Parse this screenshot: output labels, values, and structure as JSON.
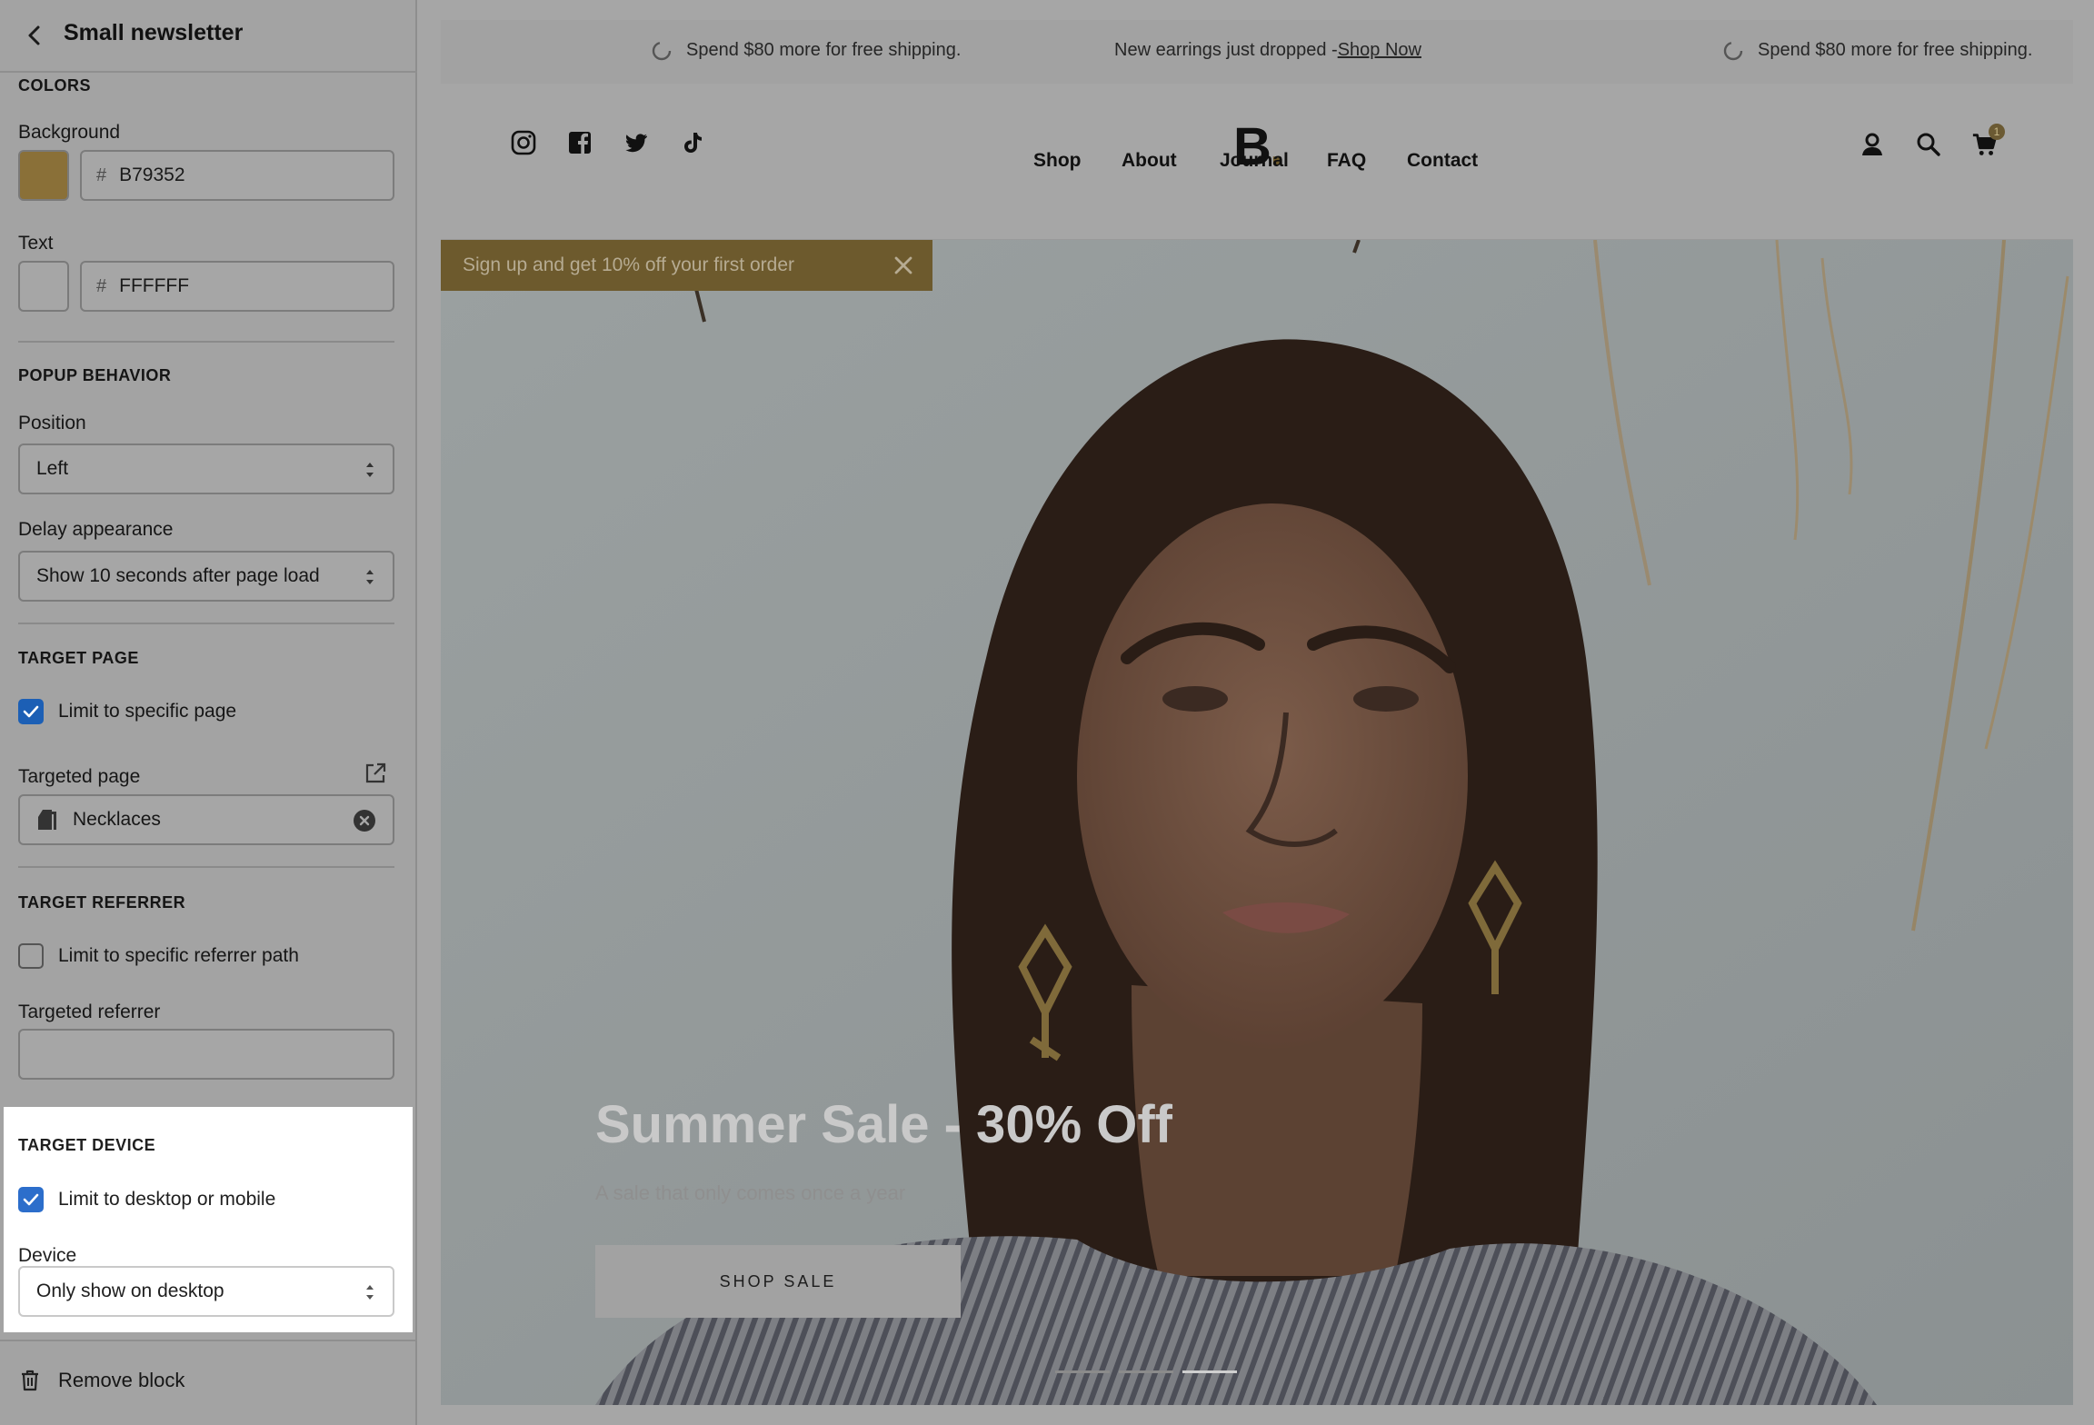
{
  "sidebar": {
    "title": "Small newsletter",
    "colors": {
      "heading": "COLORS",
      "background_label": "Background",
      "background_hash": "#",
      "background_value": "B79352",
      "background_color": "#8a7038",
      "text_label": "Text",
      "text_hash": "#",
      "text_value": "FFFFFF",
      "text_color": "#a6a6a6"
    },
    "popup_behavior": {
      "heading": "POPUP BEHAVIOR",
      "position_label": "Position",
      "position_value": "Left",
      "delay_label": "Delay appearance",
      "delay_value": "Show 10 seconds after page load"
    },
    "target_page": {
      "heading": "TARGET PAGE",
      "limit_label": "Limit to specific page",
      "limit_checked": true,
      "targeted_label": "Targeted page",
      "targeted_value": "Necklaces"
    },
    "target_referrer": {
      "heading": "TARGET REFERRER",
      "limit_label": "Limit to specific referrer path",
      "limit_checked": false,
      "targeted_label": "Targeted referrer",
      "targeted_value": ""
    },
    "target_device": {
      "heading": "TARGET DEVICE",
      "limit_label": "Limit to desktop or mobile",
      "limit_checked": true,
      "device_label": "Device",
      "device_value": "Only show on desktop"
    },
    "remove_label": "Remove block"
  },
  "preview": {
    "announcements": [
      {
        "text": "Spend $80 more for free shipping."
      },
      {
        "text": "New earrings just dropped - ",
        "link": "Shop Now"
      },
      {
        "text": "Spend $80 more for free shipping."
      }
    ],
    "logo": "B",
    "logo_dot": ".",
    "cart_count": "1",
    "nav": [
      "Shop",
      "About",
      "Journal",
      "FAQ",
      "Contact"
    ],
    "popup_text": "Sign up and get 10% off your first order",
    "hero_title": "Summer Sale - 30% Off",
    "hero_subtitle": "A sale that only comes once a year",
    "hero_button": "SHOP SALE",
    "accent_color": "#6d5a2d"
  }
}
